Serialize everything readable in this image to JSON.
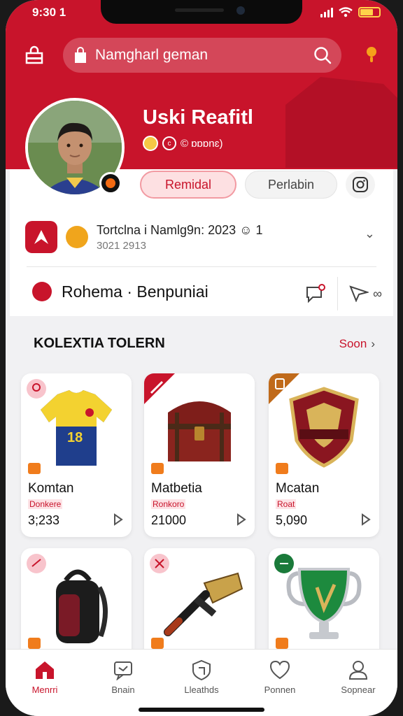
{
  "status_bar": {
    "time": "9:30 1"
  },
  "header": {
    "search_label": "Namgharl geman",
    "icons": {
      "bag": "shopping-bag-icon",
      "search": "search-icon",
      "notification": "notification-icon"
    },
    "accent_color": "#c8142b"
  },
  "profile": {
    "name": "Uski Reafitl",
    "sub_text": "© ɒɒɒnɛ)",
    "primary_button": "Remidal",
    "secondary_button": "Perlabin",
    "online_status_color": "#f36a12"
  },
  "team": {
    "title": "Tortclna i Namlg9n: 2023 ☺ 1",
    "date": "3021 2913"
  },
  "club": {
    "label": "Rohema · Benpuniai",
    "action_count": "∞"
  },
  "collection": {
    "title": "KOLEXTIA TOLERN",
    "see_all": "Soon",
    "items": [
      {
        "title": "Komtan",
        "sub": "Donkere",
        "price": "3;233",
        "icon": "jersey-icon"
      },
      {
        "title": "Matbetia",
        "sub": "Ronkoro",
        "price": "21000",
        "icon": "treasure-chest-icon"
      },
      {
        "title": "Mcatan",
        "sub": "Roat",
        "price": "5,090",
        "icon": "shield-badge-icon"
      },
      {
        "title": "",
        "sub": "",
        "price": "",
        "icon": "backpack-icon"
      },
      {
        "title": "",
        "sub": "",
        "price": "",
        "icon": "golden-hammer-icon"
      },
      {
        "title": "",
        "sub": "",
        "price": "",
        "icon": "trophy-cup-icon"
      }
    ]
  },
  "tabs": [
    {
      "label": "Menrri",
      "icon": "home-icon",
      "active": true
    },
    {
      "label": "Bnain",
      "icon": "chat-icon",
      "active": false
    },
    {
      "label": "Lleathds",
      "icon": "shield-icon",
      "active": false
    },
    {
      "label": "Ponnen",
      "icon": "heart-icon",
      "active": false
    },
    {
      "label": "Sopnear",
      "icon": "profile-icon",
      "active": false
    }
  ]
}
